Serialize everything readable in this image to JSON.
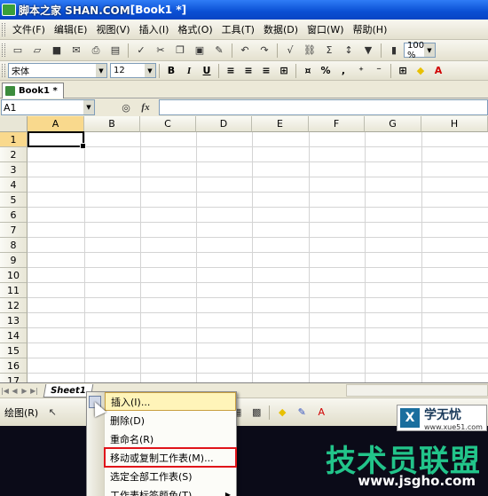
{
  "window": {
    "title_watermark": "脚本之家 SHAN.COM",
    "title_doc": "[Book1 *]"
  },
  "menu": [
    "文件(F)",
    "编辑(E)",
    "视图(V)",
    "插入(I)",
    "格式(O)",
    "工具(T)",
    "数据(D)",
    "窗口(W)",
    "帮助(H)"
  ],
  "toolbar": {
    "zoom": "100 %",
    "sigma": "Σ",
    "sort": "↕"
  },
  "format": {
    "font": "宋体",
    "size": "12",
    "bold": "B",
    "italic": "I",
    "underline": "U",
    "percent": "%",
    "comma": ","
  },
  "doc_tab": "Book1 *",
  "formula_bar": {
    "namebox": "A1",
    "fx": "fx"
  },
  "columns": [
    "A",
    "B",
    "C",
    "D",
    "E",
    "F",
    "G",
    "H"
  ],
  "rows": [
    "1",
    "2",
    "3",
    "4",
    "5",
    "6",
    "7",
    "8",
    "9",
    "10",
    "11",
    "12",
    "13",
    "14",
    "15",
    "16",
    "17"
  ],
  "sheet_tab": "Sheet1",
  "draw_bar": {
    "label": "绘图(R)"
  },
  "context_menu": [
    "插入(I)...",
    "删除(D)",
    "重命名(R)",
    "移动或复制工作表(M)...",
    "选定全部工作表(S)",
    "工作表标签颜色(T)"
  ],
  "watermark": {
    "brand": "技术员联盟",
    "url": "www.jsgho.com",
    "logo_cn": "学无忧",
    "logo_url": "www.xue51.com",
    "logo_mark": "X"
  }
}
